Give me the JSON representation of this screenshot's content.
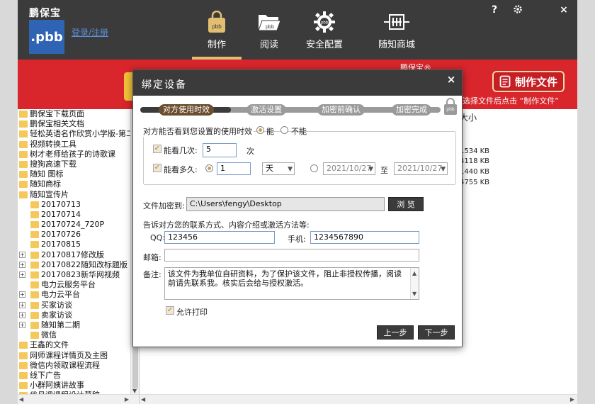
{
  "app": {
    "brand": "鹏保宝",
    "logo_text": ".pbb",
    "login_link": "登录/注册",
    "help": "?",
    "settings_icon": "gear-icon",
    "close": "×"
  },
  "nav": [
    {
      "label": "制作",
      "icon": "lock-bag-icon",
      "active": true
    },
    {
      "label": "阅读",
      "icon": "folder-open-icon",
      "active": false
    },
    {
      "label": "安全配置",
      "icon": "gear-pbb-icon",
      "active": false
    },
    {
      "label": "随知商城",
      "icon": "store-icon",
      "active": false
    }
  ],
  "banner": {
    "title": "鹏保宝®",
    "make_button": "制作文件",
    "hint": "选择文件后点击 “制作文件”"
  },
  "tree": {
    "items": [
      {
        "label": "鹏保宝下载页面",
        "indent": 0,
        "exp": ""
      },
      {
        "label": "鹏保宝相关文档",
        "indent": 0,
        "exp": ""
      },
      {
        "label": "轻松英语名作欣赏小学版-第二",
        "indent": 0,
        "exp": ""
      },
      {
        "label": "视频转换工具",
        "indent": 0,
        "exp": ""
      },
      {
        "label": "树才老师给孩子的诗歌课",
        "indent": 0,
        "exp": ""
      },
      {
        "label": "搜狗高速下载",
        "indent": 0,
        "exp": ""
      },
      {
        "label": "随知 图标",
        "indent": 0,
        "exp": ""
      },
      {
        "label": "随知商标",
        "indent": 0,
        "exp": ""
      },
      {
        "label": "随知宣传片",
        "indent": 0,
        "exp": ""
      },
      {
        "label": "20170713",
        "indent": 1,
        "exp": ""
      },
      {
        "label": "20170714",
        "indent": 1,
        "exp": ""
      },
      {
        "label": "20170724_720P",
        "indent": 1,
        "exp": ""
      },
      {
        "label": "20170726",
        "indent": 1,
        "exp": ""
      },
      {
        "label": "20170815",
        "indent": 1,
        "exp": ""
      },
      {
        "label": "20170817修改版",
        "indent": 1,
        "exp": "+"
      },
      {
        "label": "20170822随知改标题版",
        "indent": 1,
        "exp": "+"
      },
      {
        "label": "20170823新华网视频",
        "indent": 1,
        "exp": "+"
      },
      {
        "label": "电力云服务平台",
        "indent": 1,
        "exp": ""
      },
      {
        "label": "电力云平台",
        "indent": 1,
        "exp": "+"
      },
      {
        "label": "买家访谈",
        "indent": 1,
        "exp": "+"
      },
      {
        "label": "卖家访谈",
        "indent": 1,
        "exp": "+"
      },
      {
        "label": "随知第二期",
        "indent": 1,
        "exp": "+"
      },
      {
        "label": "微信",
        "indent": 1,
        "exp": ""
      },
      {
        "label": "王鑫的文件",
        "indent": 0,
        "exp": ""
      },
      {
        "label": "网师课程详情页及主图",
        "indent": 0,
        "exp": ""
      },
      {
        "label": "微信内领取课程流程",
        "indent": 0,
        "exp": ""
      },
      {
        "label": "线下广告",
        "indent": 0,
        "exp": ""
      },
      {
        "label": "小群阿姨讲故事",
        "indent": 0,
        "exp": ""
      },
      {
        "label": "优易课课程设计草稿",
        "indent": 0,
        "exp": ""
      }
    ]
  },
  "filelist": {
    "col_size": "大小",
    "sizes": [
      "1534 KB",
      "4118 KB",
      "1440 KB",
      "4755 KB"
    ]
  },
  "dialog": {
    "title": "绑定设备",
    "close": "×",
    "steps": [
      "对方使用时效",
      "激活设置",
      "加密前确认",
      "加密完成"
    ],
    "lock_label": "pbb",
    "limit_question": "对方能否看到您设置的使用时效",
    "can": "能",
    "cannot": "不能",
    "times_label": "能看几次:",
    "times_value": "5",
    "times_unit": "次",
    "duration_label": "能看多久:",
    "duration_value": "1",
    "duration_unit": "天",
    "date_from": "2021/10/27",
    "date_sep": "至",
    "date_to": "2021/10/27",
    "save_to_label": "文件加密到:",
    "save_path": "C:\\Users\\fengy\\Desktop",
    "browse": "浏 览",
    "contact_intro": "告诉对方您的联系方式、内容介绍或激活方法等:",
    "qq_label": "QQ:",
    "qq_value": "123456",
    "phone_label": "手机:",
    "phone_value": "1234567890",
    "email_label": "邮箱:",
    "email_value": "",
    "note_label": "备注:",
    "note_value": "该文件为我单位自研资料，为了保护该文件，阻止非授权传播，阅读前请先联系我。核实后会给与授权激活。",
    "allow_print": "允许打印",
    "prev": "上一步",
    "next": "下一步"
  }
}
